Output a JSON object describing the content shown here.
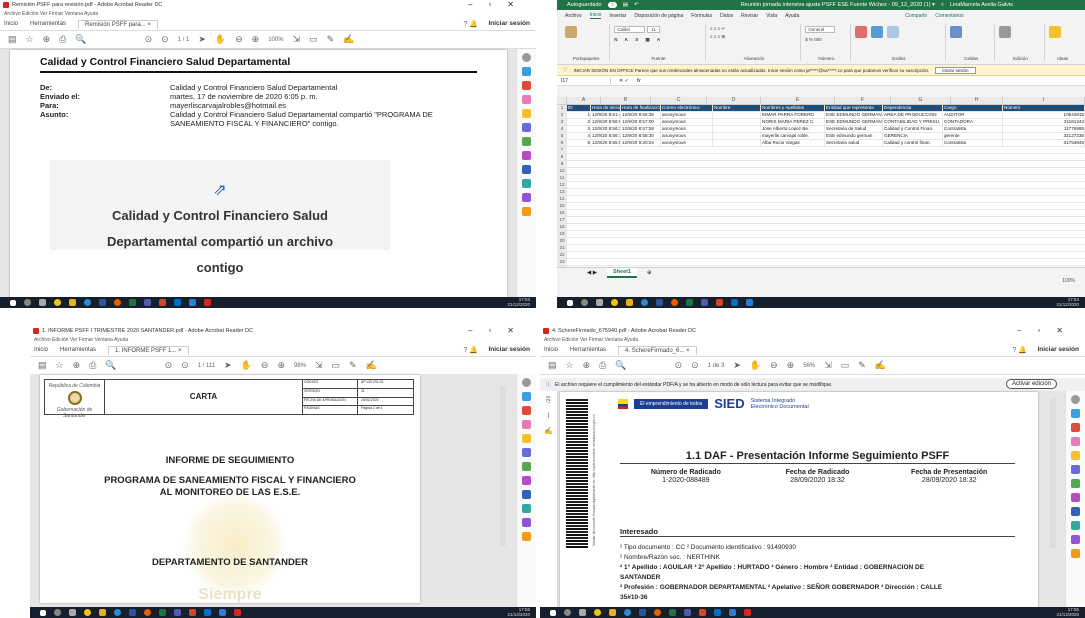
{
  "q1": {
    "title": "Remisión PSFF para revisión.pdf - Adobe Acrobat Reader DC",
    "menu": "Archivo  Edición  Ver  Firmar  Ventana  Ayuda",
    "tabs": [
      "Inicio",
      "Herramientas",
      "Remisión PSFF para... ×"
    ],
    "signin": "Iniciar sesión",
    "page_info": "1 / 1",
    "zoom": "100%",
    "heading": "Calidad y Control Financiero Salud Departamental",
    "fields": [
      {
        "k": "De:",
        "v": "Calidad y Control Financiero Salud Departamental"
      },
      {
        "k": "Enviado el:",
        "v": "martes, 17 de noviembre de 2020 6:05 p. m."
      },
      {
        "k": "Para:",
        "v": "mayerliscarvajalrobles@hotmail.es"
      },
      {
        "k": "Asunto:",
        "v": "Calidad y Control Financiero Salud Departamental compartió \"PROGRAMA DE"
      },
      {
        "k": "",
        "v": "SANEAMIENTO FISCAL Y FINANCIERO\" contigo."
      }
    ],
    "share_line1": "Calidad y Control Financiero Salud",
    "share_line2": "Departamental compartió un archivo",
    "share_line3": "contigo"
  },
  "q2": {
    "autosave": "Autoguardado",
    "title": "Reunión jornada intensiva ajuste PSFF ESE Fuente Wichez - 09_12_2020 (1) ▾",
    "user": "LinaMarcela Avella Galvis",
    "menu": [
      "Archivo",
      "Inicio",
      "Insertar",
      "Disposición de página",
      "Fórmulas",
      "Datos",
      "Revisar",
      "Vista",
      "Ayuda"
    ],
    "share": "Compartir",
    "comments": "Comentarios",
    "ribbon_groups": [
      "Portapapeles",
      "Fuente",
      "Alineación",
      "Número",
      "Estilos",
      "Celdas",
      "Edición",
      "Ideas"
    ],
    "font_name": "Calibri",
    "font_size": "11",
    "number_format": "General",
    "signin_bar": "INICIAR SESIÓN EN OFFICE   Parece que sus credenciales almacenadas no están actualizadas. Inicie sesión como ja*****@sa*****.co para que podamos verificar su suscripción.",
    "signin_btn": "Iniciar sesión",
    "cell_ref": "I17",
    "fx": "fx",
    "col_letters": [
      "A",
      "B",
      "C",
      "D",
      "E",
      "F",
      "G",
      "H",
      "I"
    ],
    "headers": [
      "ID",
      "Hora de inicio",
      "Hora de finalización",
      "Correo electrónico",
      "Nombre",
      "Nombres y Apellidos",
      "Entidad que representa",
      "Dependencia",
      "Cargo",
      "Número"
    ],
    "rows": [
      [
        "1",
        "12/9/20 8:51:42",
        "12/9/20 8:55:35",
        "anonymous",
        "",
        "EIMAR PARRA FORERO",
        "ESE EDMUNDO GERMAN",
        "AREA DE PRODUCCION",
        "AUDITOR",
        "10644815"
      ],
      [
        "2",
        "12/9/20 8:56:00",
        "12/9/20 8:57:00",
        "anonymous",
        "",
        "NORIS MARIA PEREZ C.",
        "ESE EDMUNDO GERMAN",
        "CONTABILIDAD Y PRESU.",
        "CONTADORA",
        "31161243"
      ],
      [
        "3",
        "12/9/20 8:56:38",
        "12/9/20 8:57:58",
        "anonymous",
        "",
        "Jose Alberto Lopez Be.",
        "Secretaria de Salud",
        "Calidad y Control Finan.",
        "Contratista",
        "11776995"
      ],
      [
        "4",
        "12/9/20 8:56:15",
        "12/9/20 8:58:30",
        "anonymous",
        "",
        "mayerlis carvajal roble.",
        "ESE edmundo german",
        "GERENCIA",
        "gerente",
        "32127235"
      ],
      [
        "5",
        "12/9/20 8:55:58",
        "12/9/20 9:20:04",
        "anonymous",
        "",
        "Alba Rocio Vargas",
        "Secretaria salud",
        "Calidad y control finan.",
        "Contratista",
        "31753849"
      ]
    ],
    "empty_rows": [
      "7",
      "8",
      "9",
      "10",
      "11",
      "12",
      "13",
      "14",
      "15",
      "16",
      "17",
      "18",
      "19",
      "20",
      "21",
      "22",
      "23",
      "24",
      "25",
      "26"
    ],
    "sheet_tab": "Sheet1",
    "zoom": "100%"
  },
  "q3": {
    "title": "1. INFORME PSFF I TRIMESTRE 2020 SANTANDER.pdf - Adobe Acrobat Reader DC",
    "menu": "Archivo  Edición  Ver  Firmar  Ventana  Ayuda",
    "tabs": [
      "Inicio",
      "Herramientas",
      "1. INFORME PSFF 1... ×"
    ],
    "signin": "Iniciar sesión",
    "page_info": "1 / 111",
    "zoom": "98%",
    "logo_line1": "República de Colombia",
    "logo_line2": "Gobernación de Santander",
    "doc_type": "CARTA",
    "meta": [
      {
        "k": "CÓDIGO",
        "v": "AP-GD-RG-01"
      },
      {
        "k": "VERSIÓN",
        "v": "11"
      },
      {
        "k": "FECHA DE APROBACIÓN",
        "v": "10/01/2020"
      },
      {
        "k": "PÁGINAS",
        "v": "Página 1 de 1"
      }
    ],
    "line1": "INFORME DE SEGUIMIENTO",
    "line2": "PROGRAMA DE SANEAMIENTO FISCAL Y FINANCIERO",
    "line3": "AL MONITOREO DE LAS E.S.E.",
    "line4": "DEPARTAMENTO DE SANTANDER",
    "watermark": "Siempre"
  },
  "q4": {
    "title": "4. SchereFirmado_675940.pdf - Adobe Acrobat Reader DC",
    "menu": "Archivo  Edición  Ver  Firmar  Ventana  Ayuda",
    "tabs": [
      "Inicio",
      "Herramientas",
      "4. SchereFirmado_6... ×"
    ],
    "signin": "Iniciar sesión",
    "page_info": "1 de 3",
    "zoom": "56%",
    "info": "El archivo requiere el cumplimiento del estándar PDF/A y se ha abierto en modo de sólo lectura para evitar que se modifique.",
    "activate": "Activar edición",
    "ministry": "El emprendimiento de todos",
    "sied": "SIED",
    "sied_sub1": "Sistema Integrado",
    "sied_sub2": "Electrónico Documental",
    "vertical_text": "Validar documento firmado digitalmente en: http://aplicacionesc.mineducacion.gov.co",
    "heading": "1.1 DAF - Presentación Informe Seguimiento PSFF",
    "col1_label": "Número de Radicado",
    "col1_value": "1-2020-088489",
    "col2_label": "Fecha de Radicado",
    "col2_value": "28/09/2020 18:32",
    "col3_label": "Fecha de Presentación",
    "col3_value": "28/09/2020 18:32",
    "section": "Interesado",
    "d1": "² Tipo documento  : CC   ² Documento identificativo  : 91490930",
    "d2": "² Nombre/Razón soc.  : NERTHINK",
    "d3": "² 1° Apellido  : AGUILAR   ² 2° Apellido  : HURTADO   ² Género  : Hombre   ² Entidad  : GOBERNACION DE",
    "d4": "SANTANDER",
    "d5": "² Profesión  : GOBERNADOR DEPARTAMENTAL   ² Apelativo  : SEÑOR GOBERNADOR   ² Dirección  : CALLE",
    "d6": "35#10-36"
  },
  "taskbars": [
    {
      "time": "17:53",
      "date": "21/12/2020"
    },
    {
      "time": "17:54",
      "date": "21/12/2020"
    },
    {
      "time": "17:56",
      "date": "21/12/2020"
    },
    {
      "time": "17:55",
      "date": "21/12/2020"
    }
  ],
  "colors": {
    "acrobat_red": "#d7261e",
    "excel_green": "#217346",
    "taskbar": "#16202c"
  }
}
